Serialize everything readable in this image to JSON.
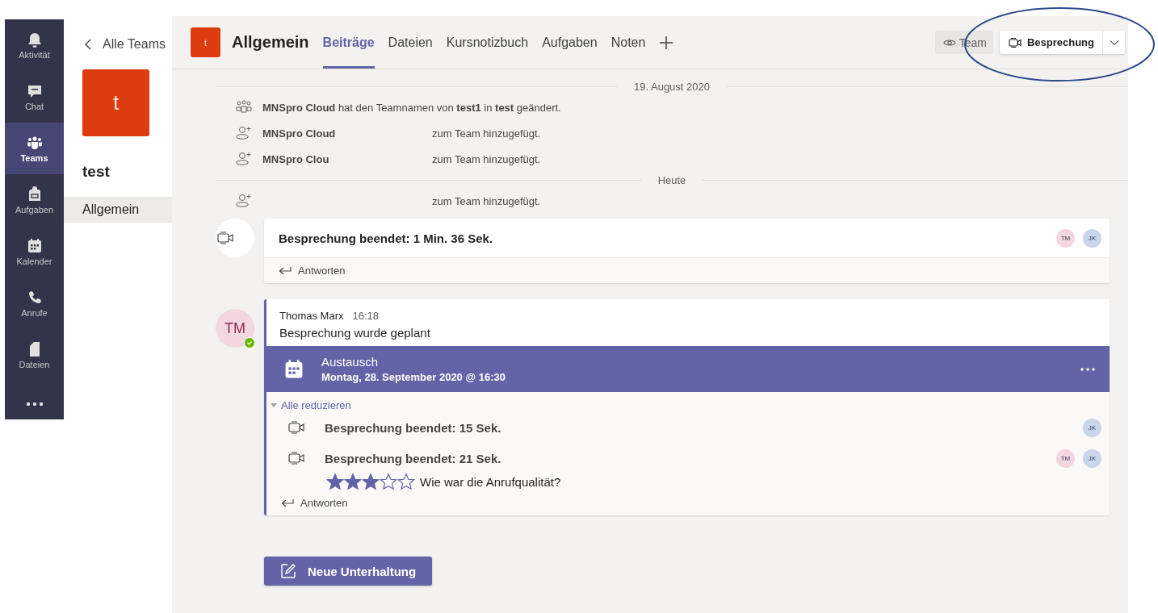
{
  "rail": {
    "items": [
      {
        "label": "Aktivität",
        "kind": "bell",
        "selected": false
      },
      {
        "label": "Chat",
        "kind": "chat",
        "selected": false
      },
      {
        "label": "Teams",
        "kind": "teams",
        "selected": true
      },
      {
        "label": "Aufgaben",
        "kind": "bag",
        "selected": false
      },
      {
        "label": "Kalender",
        "kind": "calendar",
        "selected": false
      },
      {
        "label": "Anrufe",
        "kind": "phone",
        "selected": false
      },
      {
        "label": "Dateien",
        "kind": "file",
        "selected": false
      }
    ]
  },
  "team_panel": {
    "back_link": "Alle Teams",
    "avatar": "t",
    "name": "test",
    "channels": [
      {
        "label": "Allgemein",
        "selected": true
      }
    ]
  },
  "header": {
    "avatar": "t",
    "title": "Allgemein",
    "tabs": [
      {
        "label": "Beiträge",
        "selected": true
      },
      {
        "label": "Dateien",
        "selected": false
      },
      {
        "label": "Kursnotizbuch",
        "selected": false
      },
      {
        "label": "Aufgaben",
        "selected": false
      },
      {
        "label": "Noten",
        "selected": false
      }
    ],
    "team_button": "Team",
    "meet_button": "Besprechung"
  },
  "annotation": {
    "kind": "ellipse"
  },
  "feed": [
    {
      "kind": "divider",
      "label": "19. August 2020"
    },
    {
      "kind": "rename",
      "text": "**MNSpro Cloud** hat den Teamnamen von **test1** in **test** geändert."
    },
    {
      "kind": "event",
      "actor": "MNSpro Cloud",
      "redacted": true,
      "text": "zum Team hinzugefügt."
    },
    {
      "kind": "event",
      "actor": "MNSpro Clou",
      "redacted": true,
      "text": "zum Team hinzugefügt."
    },
    {
      "kind": "divider",
      "label": "Heute"
    },
    {
      "kind": "event",
      "redacted": true,
      "text": "zum Team hinzugefügt."
    },
    {
      "kind": "meeting",
      "text": "Besprechung beendet: 1 Min. 36 Sek.",
      "participants": [
        {
          "initials": "TM",
          "color": "#f4d6e0"
        },
        {
          "initials": "JK",
          "color": "#c9d6ea"
        }
      ],
      "reply": "Antworten"
    },
    {
      "kind": "post",
      "author": {
        "initials": "TM",
        "color": "#f4d6e0",
        "online": true
      },
      "name": "Thomas Marx",
      "time": "16:18",
      "body": "Besprechung wurde geplant",
      "event": {
        "title": "Austausch",
        "when": "Montag, 28. September 2020 @ 16:30"
      },
      "collapse": "Alle reduzieren",
      "calls": [
        {
          "text": "Besprechung beendet: 15 Sek.",
          "participants": [
            {
              "initials": "JK",
              "color": "#c9d6ea"
            }
          ]
        },
        {
          "text": "Besprechung beendet: 21 Sek.",
          "participants": [
            {
              "initials": "TM",
              "color": "#f4d6e0"
            },
            {
              "initials": "JK",
              "color": "#c9d6ea"
            }
          ],
          "rating": {
            "stars": 3,
            "prompt": "Wie war die Anrufqualität?"
          }
        }
      ],
      "reply": "Antworten"
    }
  ],
  "new_conversation": "Neue Unterhaltung"
}
